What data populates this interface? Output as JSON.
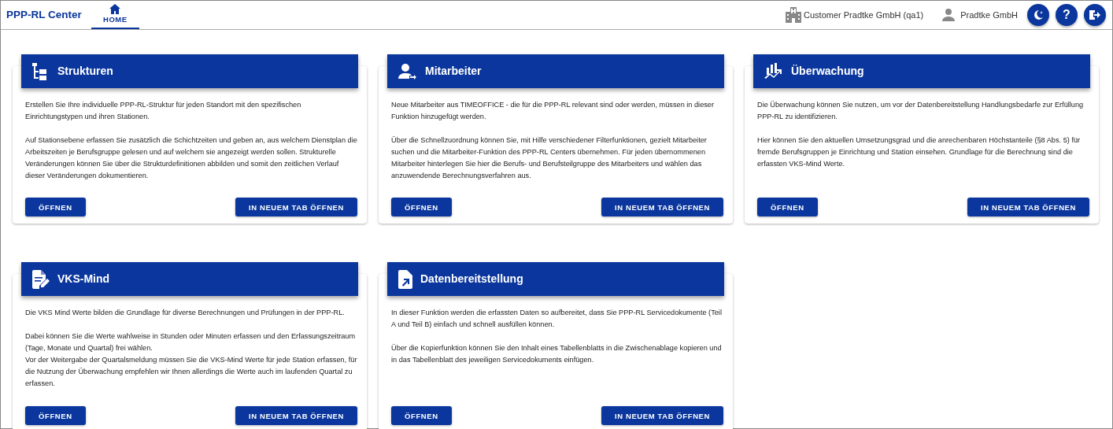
{
  "header": {
    "app_title": "PPP-RL Center",
    "tabs": [
      {
        "label": "HOME",
        "selected": true
      }
    ],
    "customer": "Customer Pradtke GmbH (qa1)",
    "user": "Pradtke GmbH",
    "action_buttons": [
      {
        "kind": "theme"
      },
      {
        "kind": "help",
        "label": "?"
      },
      {
        "kind": "logout"
      }
    ]
  },
  "cards": [
    {
      "title": "Strukturen",
      "paragraphs": [
        "Erstellen Sie Ihre individuelle PPP-RL-Struktur für jeden Standort mit den spezifischen Einrichtungstypen und ihren Stationen.",
        "Auf Stationsebene erfassen Sie zusätzlich die Schichtzeiten und geben an, aus welchem Dienstplan die Arbeitszeiten je Berufsgruppe gelesen und auf welchem sie angezeigt werden sollen. Strukturelle Veränderungen können Sie über die Strukturdefinitionen abbilden und somit den zeitlichen Verlauf dieser Veränderungen dokumentieren."
      ],
      "buttons": [
        "ÖFFNEN",
        "IN NEUEM TAB ÖFFNEN"
      ]
    },
    {
      "title": "Mitarbeiter",
      "paragraphs": [
        "Neue Mitarbeiter aus TIMEOFFICE - die für die PPP-RL relevant sind oder werden, müssen in dieser Funktion hinzugefügt werden.",
        "Über die Schnellzuordnung können Sie, mit Hilfe verschiedener Filterfunktionen, gezielt Mitarbeiter suchen und die Mitarbeiter-Funktion des PPP-RL Centers übernehmen. Für jeden übernommenen Mitarbeiter hinterlegen Sie hier die Berufs- und Berufsteilgruppe des Mitarbeiters und wählen das anzuwendende Berechnungsverfahren aus."
      ],
      "buttons": [
        "ÖFFNEN",
        "IN NEUEM TAB ÖFFNEN"
      ]
    },
    {
      "title": "Überwachung",
      "paragraphs": [
        "Die Überwachung können Sie nutzen, um vor der Datenbereitstellung Handlungsbedarfe zur Erfüllung PPP-RL zu identifizieren.",
        "Hier können Sie den aktuellen Umsetzungsgrad und die anrechenbaren Höchstanteile (§8 Abs. 5) für fremde Berufsgruppen je Einrichtung und Station einsehen. Grundlage für die Berechnung sind die erfassten VKS-Mind Werte."
      ],
      "buttons": [
        "ÖFFNEN",
        "IN NEUEM TAB ÖFFNEN"
      ]
    },
    {
      "title": "VKS-Mind",
      "paragraphs": [
        "Die VKS Mind Werte bilden die Grundlage für diverse Berechnungen und Prüfungen in der PPP-RL.",
        "Dabei können Sie die Werte wahlweise in Stunden oder Minuten erfassen und den Erfassungszeitraum (Tage, Monate und Quartal) frei wählen.\nVor der Weitergabe der Quartalsmeldung müssen Sie die VKS-Mind Werte für jede Station erfassen, für die Nutzung der Überwachung empfehlen wir Ihnen allerdings die Werte auch im laufenden Quartal zu erfassen."
      ],
      "buttons": [
        "ÖFFNEN",
        "IN NEUEM TAB ÖFFNEN"
      ]
    },
    {
      "title": "Datenbereitstellung",
      "paragraphs": [
        "In dieser Funktion werden die erfassten Daten so aufbereitet, dass Sie PPP-RL Servicedokumente (Teil A und Teil B) einfach und schnell ausfüllen können.",
        "Über die Kopierfunktion können Sie den Inhalt eines Tabellenblatts in die Zwischenablage kopieren und in das Tabellenblatt des jeweiligen Servicedokuments einfügen."
      ],
      "buttons": [
        "ÖFFNEN",
        "IN NEUEM TAB ÖFFNEN"
      ]
    }
  ]
}
